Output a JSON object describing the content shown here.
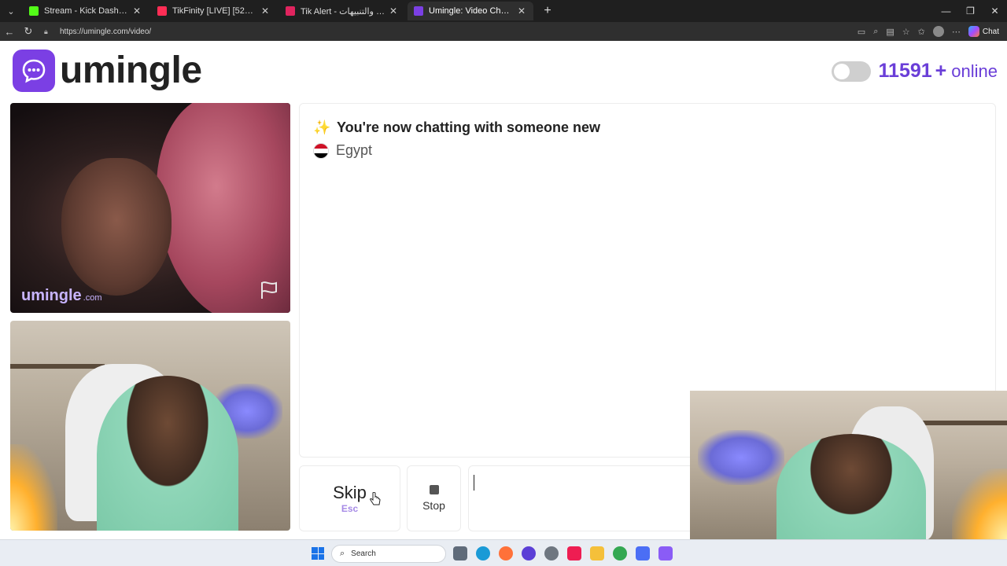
{
  "browser": {
    "tabs": [
      {
        "title": "Stream - Kick Dashboard",
        "color": "#53fc18",
        "active": false
      },
      {
        "title": "TikFinity [LIVE] [521 Viewers]",
        "color": "#ff2d55",
        "active": false
      },
      {
        "title": "Tik Alert - منصة الإشعارات والتنبيهات",
        "color": "#e0245e",
        "active": false
      },
      {
        "title": "Umingle: Video Chat with Strangers",
        "color": "#7b3fe4",
        "active": true
      }
    ],
    "url": "https://umingle.com/video/",
    "copilot_label": "Chat"
  },
  "site": {
    "brand_name": "umingle",
    "online_count": "11591",
    "online_plus": "+",
    "online_label": "online",
    "accent": "#6a3ed8"
  },
  "stranger_video": {
    "watermark": "umingle",
    "watermark_suffix": ".com"
  },
  "chat": {
    "message": "You're now chatting with someone new",
    "country": "Egypt"
  },
  "controls": {
    "skip_label": "Skip",
    "skip_key": "Esc",
    "stop_label": "Stop",
    "message_value": ""
  },
  "taskbar": {
    "search_label": "Search"
  }
}
